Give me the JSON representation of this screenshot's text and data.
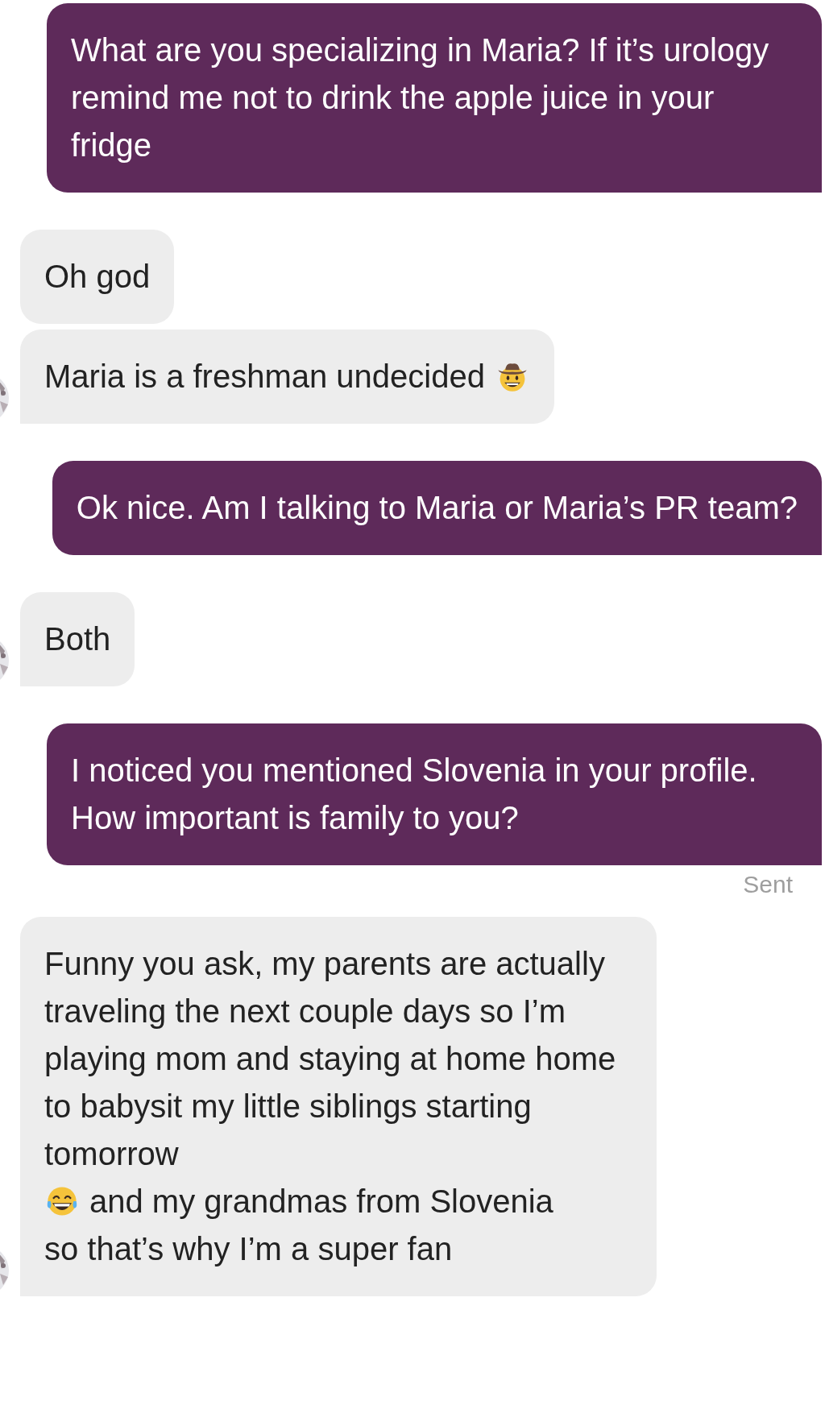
{
  "messages": [
    {
      "kind": "sent",
      "parts": [
        {
          "kind": "text",
          "text": "What are you specializing in Maria? If it’s urology remind me not to drink the apple juice in your fridge"
        }
      ]
    },
    {
      "kind": "received",
      "avatar": false,
      "parts": [
        {
          "kind": "text",
          "text": "Oh god"
        }
      ]
    },
    {
      "kind": "received",
      "avatar": true,
      "parts": [
        {
          "kind": "text",
          "text": "Maria is a freshman undecided"
        },
        {
          "kind": "cowboy"
        }
      ]
    },
    {
      "kind": "sent",
      "parts": [
        {
          "kind": "text",
          "text": "Ok nice. Am I talking to Maria or Maria’s PR team?"
        }
      ]
    },
    {
      "kind": "received",
      "avatar": true,
      "parts": [
        {
          "kind": "text",
          "text": "Both"
        }
      ]
    },
    {
      "kind": "sent",
      "status": "Sent",
      "parts": [
        {
          "kind": "text",
          "text": "I noticed you mentioned Slovenia in your profile. How important is family to you?"
        }
      ]
    },
    {
      "kind": "received",
      "avatar": true,
      "parts": [
        {
          "kind": "text",
          "text": "Funny you ask, my parents are actually traveling the next couple days so I’m playing mom and staying at home home to babysit my little siblings starting tomorrow"
        },
        {
          "kind": "laughing"
        },
        {
          "kind": "text",
          "text": "and my grandmas from Slovenia"
        },
        {
          "kind": "text",
          "text": "so that’s why I’m a super fan"
        }
      ]
    }
  ]
}
